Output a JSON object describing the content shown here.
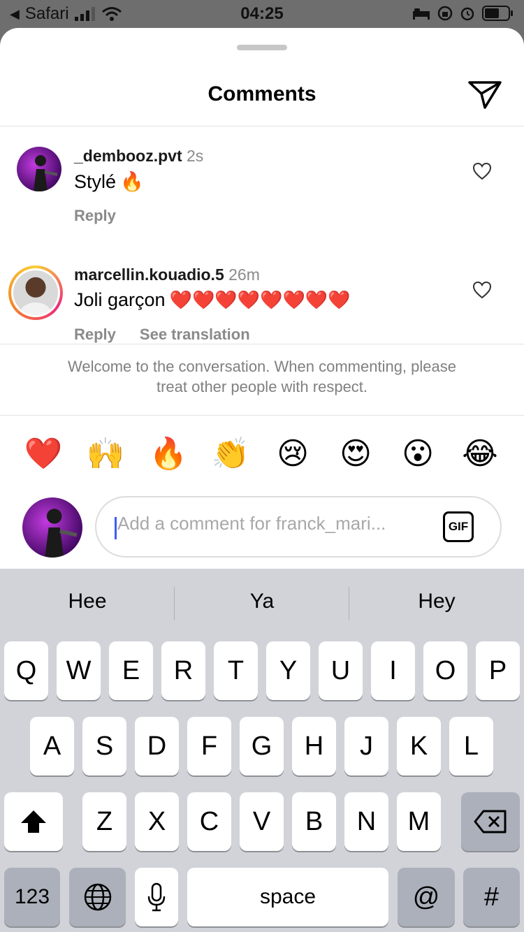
{
  "status_bar": {
    "back_app": "Safari",
    "time": "04:25"
  },
  "sheet": {
    "title": "Comments"
  },
  "comments": [
    {
      "username": "_dembooz.pvt",
      "time": "2s",
      "text": "Stylé",
      "emoji": "🔥",
      "actions": [
        "Reply"
      ]
    },
    {
      "username": "marcellin.kouadio.5",
      "time": "26m",
      "text": "Joli garçon",
      "emoji": "❤️❤️❤️❤️❤️❤️❤️❤️",
      "actions": [
        "Reply",
        "See translation"
      ]
    }
  ],
  "welcome_message": "Welcome to the conversation. When commenting, please treat other people with respect.",
  "quick_emojis": [
    "❤️",
    "🙌",
    "🔥",
    "👏",
    "😢",
    "😍",
    "😮",
    "😂"
  ],
  "composer": {
    "placeholder": "Add a comment for franck_mari...",
    "gif_label": "GIF"
  },
  "keyboard": {
    "suggestions": [
      "Hee",
      "Ya",
      "Hey"
    ],
    "row1": [
      "Q",
      "W",
      "E",
      "R",
      "T",
      "Y",
      "U",
      "I",
      "O",
      "P"
    ],
    "row2": [
      "A",
      "S",
      "D",
      "F",
      "G",
      "H",
      "J",
      "K",
      "L"
    ],
    "row3": [
      "Z",
      "X",
      "C",
      "V",
      "B",
      "N",
      "M"
    ],
    "numbers_label": "123",
    "space_label": "space",
    "at_label": "@",
    "hash_label": "#"
  }
}
